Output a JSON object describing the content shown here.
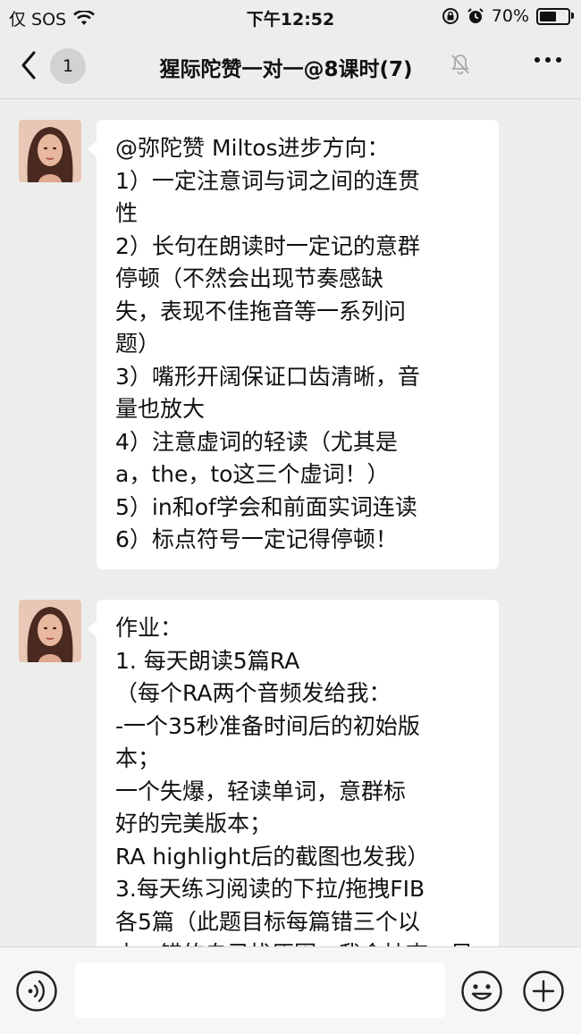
{
  "status_bar": {
    "carrier": "仅 SOS",
    "time": "下午12:52",
    "battery_text": "70%",
    "battery_level": 0.7
  },
  "nav": {
    "unread_count": "1",
    "title": "猩际陀赞一对一@8课时(7)"
  },
  "messages": [
    {
      "lines": [
        "@弥陀赞 Miltos进步方向：",
        "1）一定注意词与词之间的连贯",
        "性",
        "2）长句在朗读时一定记的意群",
        "停顿（不然会出现节奏感缺",
        "失，表现不佳拖音等一系列问",
        "题）",
        "3）嘴形开阔保证口齿清晰，音",
        "量也放大",
        "4）注意虚词的轻读（尤其是",
        "a，the，to这三个虚词！）",
        "5）in和of学会和前面实词连读",
        "6）标点符号一定记得停顿！"
      ]
    },
    {
      "lines": [
        "作业：",
        "1. 每天朗读5篇RA",
        "（每个RA两个音频发给我：",
        "-一个35秒准备时间后的初始版",
        "本；",
        "一个失爆，轻读单词，意群标",
        "好的完美版本；",
        "RA highlight后的截图也发我）",
        "3.每天练习阅读的下拉/拖拽FIB",
        "各5篇（此题目标每篇错三个以",
        "内，错的自己找原因，我会抽查，另"
      ]
    }
  ],
  "input_bar": {
    "message_value": ""
  },
  "colors": {
    "background": "#ededed",
    "bubble": "#ffffff",
    "input_bar": "#f6f6f6"
  },
  "icons": [
    "wifi-icon",
    "back-arrow-icon",
    "mute-bell-icon",
    "more-icon",
    "voice-icon",
    "emoji-icon",
    "plus-icon",
    "lock-rotation-icon",
    "alarm-icon"
  ]
}
